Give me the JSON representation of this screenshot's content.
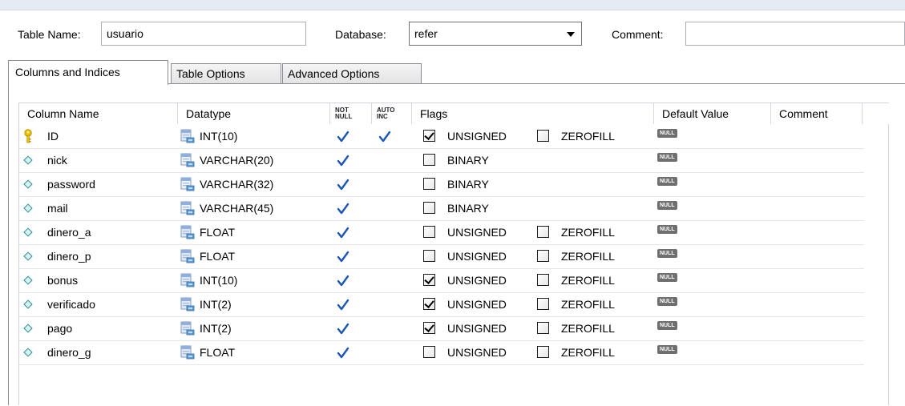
{
  "header": {
    "table_name_label": "Table Name:",
    "table_name_value": "usuario",
    "database_label": "Database:",
    "database_value": "refer",
    "comment_label": "Comment:",
    "comment_value": ""
  },
  "tabs": [
    {
      "label": "Columns and Indices",
      "active": true
    },
    {
      "label": "Table Options",
      "active": false
    },
    {
      "label": "Advanced Options",
      "active": false
    }
  ],
  "grid": {
    "headers": {
      "column_name": "Column Name",
      "datatype": "Datatype",
      "not_null_top": "NOT",
      "not_null_bottom": "NULL",
      "auto_inc_top": "AUTO",
      "auto_inc_bottom": "INC",
      "flags": "Flags",
      "default_value": "Default Value",
      "comment": "Comment"
    },
    "null_badge": "NULL",
    "flag_unsigned": "UNSIGNED",
    "flag_zerofill": "ZEROFILL",
    "flag_binary": "BINARY",
    "rows": [
      {
        "name": "ID",
        "datatype": "INT(10)",
        "pk": true,
        "not_null": true,
        "auto_inc": true,
        "flags": "numeric",
        "unsigned": true,
        "zerofill": false
      },
      {
        "name": "nick",
        "datatype": "VARCHAR(20)",
        "pk": false,
        "not_null": true,
        "auto_inc": false,
        "flags": "text",
        "binary": false
      },
      {
        "name": "password",
        "datatype": "VARCHAR(32)",
        "pk": false,
        "not_null": true,
        "auto_inc": false,
        "flags": "text",
        "binary": false
      },
      {
        "name": "mail",
        "datatype": "VARCHAR(45)",
        "pk": false,
        "not_null": true,
        "auto_inc": false,
        "flags": "text",
        "binary": false
      },
      {
        "name": "dinero_a",
        "datatype": "FLOAT",
        "pk": false,
        "not_null": true,
        "auto_inc": false,
        "flags": "numeric",
        "unsigned": false,
        "zerofill": false
      },
      {
        "name": "dinero_p",
        "datatype": "FLOAT",
        "pk": false,
        "not_null": true,
        "auto_inc": false,
        "flags": "numeric",
        "unsigned": false,
        "zerofill": false
      },
      {
        "name": "bonus",
        "datatype": "INT(10)",
        "pk": false,
        "not_null": true,
        "auto_inc": false,
        "flags": "numeric",
        "unsigned": true,
        "zerofill": false
      },
      {
        "name": "verificado",
        "datatype": "INT(2)",
        "pk": false,
        "not_null": true,
        "auto_inc": false,
        "flags": "numeric",
        "unsigned": true,
        "zerofill": false
      },
      {
        "name": "pago",
        "datatype": "INT(2)",
        "pk": false,
        "not_null": true,
        "auto_inc": false,
        "flags": "numeric",
        "unsigned": true,
        "zerofill": false
      },
      {
        "name": "dinero_g",
        "datatype": "FLOAT",
        "pk": false,
        "not_null": true,
        "auto_inc": false,
        "flags": "numeric",
        "unsigned": false,
        "zerofill": false
      }
    ]
  },
  "icons": {
    "primary_key": "key-icon",
    "column": "column-diamond-icon",
    "datatype": "datatype-icon",
    "check": "checkmark-icon"
  },
  "colors": {
    "background": "#e4ebf5",
    "checkmark": "#1b56b8",
    "key": "#f2c300"
  }
}
